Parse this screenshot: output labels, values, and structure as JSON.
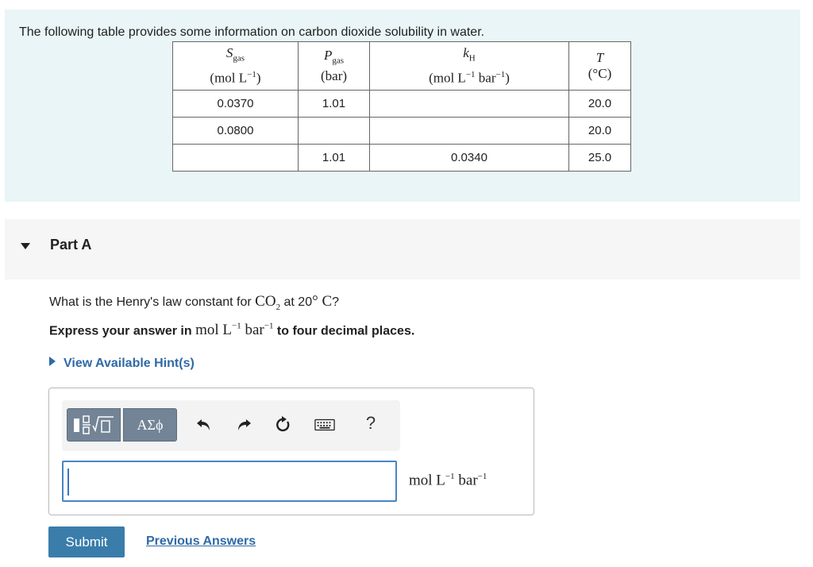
{
  "intro": {
    "text": "The following table provides some information on carbon dioxide solubility in water."
  },
  "table": {
    "headers": [
      {
        "symbol": "S",
        "sub": "gas",
        "unit_pre": "(mol L",
        "unit_exp": "−1",
        "unit_post": ")",
        "unit2": "",
        "unit2_exp": ""
      },
      {
        "symbol": "P",
        "sub": "gas",
        "unit_pre": "(bar)",
        "unit_exp": "",
        "unit_post": "",
        "unit2": "",
        "unit2_exp": ""
      },
      {
        "symbol": "k",
        "sub": "H",
        "unit_pre": "(mol L",
        "unit_exp": "−1",
        "unit_post": "",
        "unit2": " bar",
        "unit2_exp": "−1"
      },
      {
        "symbol": "T",
        "sub": "",
        "unit_pre": "(°C)",
        "unit_exp": "",
        "unit_post": "",
        "unit2": "",
        "unit2_exp": ""
      }
    ],
    "rows": [
      [
        "0.0370",
        "1.01",
        "",
        "20.0"
      ],
      [
        "0.0800",
        "",
        "",
        "20.0"
      ],
      [
        "",
        "1.01",
        "0.0340",
        "25.0"
      ]
    ]
  },
  "part": {
    "title": "Part A"
  },
  "question": {
    "pre": "What is the Henry's law constant for ",
    "species": "CO",
    "species_sub": "2",
    "mid": " at 20",
    "degree": "° C",
    "post": "?"
  },
  "instruction": {
    "pre": "Express your answer in ",
    "unit_a": "mol L",
    "exp_a": "−1",
    "unit_b": " bar",
    "exp_b": "−1",
    "post": " to four decimal places."
  },
  "hint": {
    "label": "View Available Hint(s)"
  },
  "toolbar": {
    "symbols_label": "ΑΣϕ",
    "help_label": "?"
  },
  "answer": {
    "value": "",
    "unit_a": "mol L",
    "exp_a": "−1",
    "unit_b": " bar",
    "exp_b": "−1"
  },
  "buttons": {
    "submit": "Submit",
    "previous": "Previous Answers"
  }
}
